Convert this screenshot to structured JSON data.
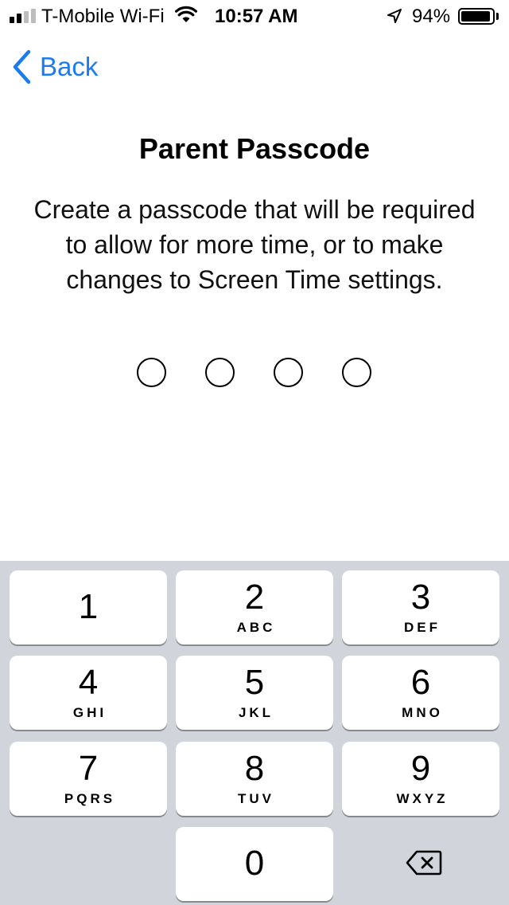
{
  "status_bar": {
    "carrier": "T-Mobile Wi-Fi",
    "time": "10:57 AM",
    "battery_percent": "94%",
    "battery_level": 0.94,
    "signal_bars_filled": 2,
    "signal_bars_total": 4,
    "icons": [
      "signal-icon",
      "wifi-icon",
      "location-arrow-icon",
      "battery-icon"
    ]
  },
  "nav": {
    "back_label": "Back",
    "accent_color": "#1a7cf0"
  },
  "content": {
    "title": "Parent Passcode",
    "description": "Create a passcode that will be required to allow for more time, or to make changes to Screen Time settings.",
    "passcode_length": 4,
    "digits_entered": 0
  },
  "keypad": {
    "keys": [
      {
        "digit": "1",
        "letters": ""
      },
      {
        "digit": "2",
        "letters": "ABC"
      },
      {
        "digit": "3",
        "letters": "DEF"
      },
      {
        "digit": "4",
        "letters": "GHI"
      },
      {
        "digit": "5",
        "letters": "JKL"
      },
      {
        "digit": "6",
        "letters": "MNO"
      },
      {
        "digit": "7",
        "letters": "PQRS"
      },
      {
        "digit": "8",
        "letters": "TUV"
      },
      {
        "digit": "9",
        "letters": "WXYZ"
      },
      {
        "digit": "0",
        "letters": ""
      }
    ],
    "delete_icon": "backspace-icon",
    "background_color": "#d1d5db"
  }
}
